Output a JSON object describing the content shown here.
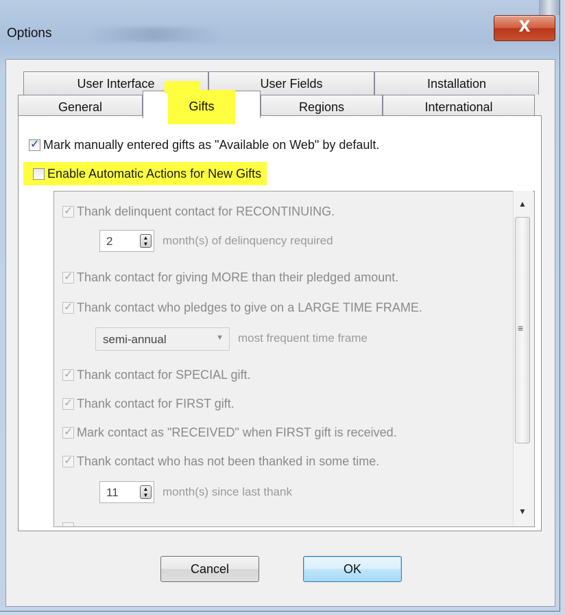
{
  "window": {
    "title": "Options",
    "close_label": "X"
  },
  "tabs_back": [
    "User Interface",
    "User Fields",
    "Installation"
  ],
  "tabs_front": [
    "General",
    "Gifts",
    "Regions",
    "International"
  ],
  "active_tab": "Gifts",
  "options": {
    "mark_web": {
      "label": "Mark manually entered gifts as \"Available on Web\" by default.",
      "checked": true
    },
    "enable_auto": {
      "label": "Enable Automatic Actions for New Gifts",
      "checked": false
    }
  },
  "auto_actions": {
    "recontinuing": "Thank delinquent contact for RECONTINUING.",
    "delinquency_months": "2",
    "delinquency_hint": "month(s) of delinquency required",
    "giving_more": "Thank contact for giving MORE than their pledged amount.",
    "large_time_frame": "Thank contact who pledges to give on a LARGE TIME FRAME.",
    "time_frame_value": "semi-annual",
    "time_frame_hint": "most frequent time frame",
    "special_gift": "Thank contact for SPECIAL gift.",
    "first_gift": "Thank contact for FIRST gift.",
    "mark_received": "Mark contact as \"RECEIVED\" when FIRST gift is received.",
    "not_thanked": "Thank contact who has not been thanked in some time.",
    "last_thank_months": "11",
    "last_thank_hint": "month(s) since last thank"
  },
  "buttons": {
    "cancel": "Cancel",
    "ok": "OK"
  },
  "colors": {
    "highlight": "#ffff40",
    "dialog_bg": "#f0f0f0",
    "close_red": "#c9502e"
  }
}
